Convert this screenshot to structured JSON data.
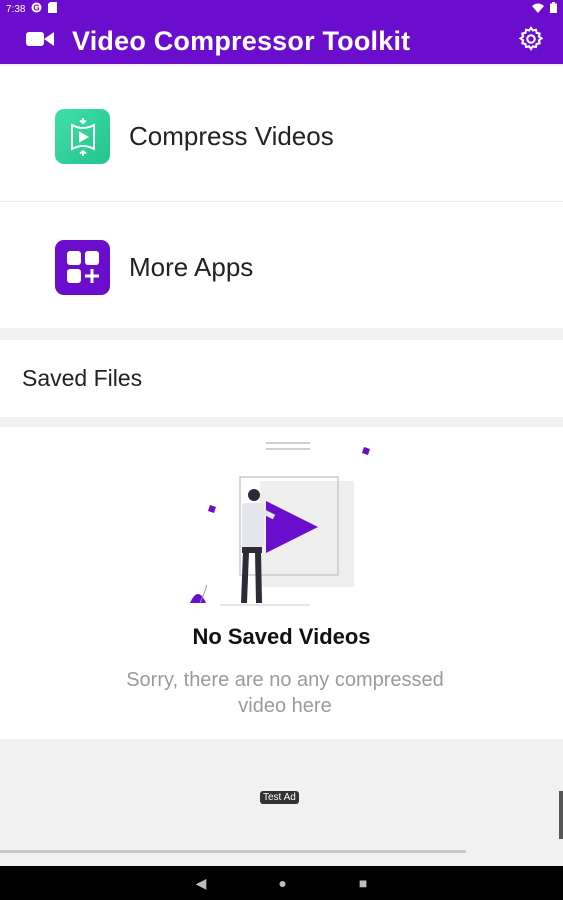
{
  "status_bar": {
    "time": "7:38",
    "left_icons": [
      "google-g-icon",
      "sd-card-icon"
    ],
    "right_icons": [
      "wifi-icon",
      "battery-icon"
    ]
  },
  "app_bar": {
    "title": "Video Compressor Toolkit",
    "left_icon": "video-camera-icon",
    "right_icon": "gear-icon",
    "color": "#6a0dcc"
  },
  "menu": {
    "items": [
      {
        "label": "Compress Videos",
        "icon": "compress-video-icon",
        "icon_color": "#2fd29a"
      },
      {
        "label": "More Apps",
        "icon": "apps-grid-plus-icon",
        "icon_color": "#6a0dcc"
      }
    ]
  },
  "saved_files": {
    "title": "Saved Files"
  },
  "empty_state": {
    "title": "No Saved Videos",
    "subtitle": "Sorry, there are no any compressed video here",
    "illustration": "person-video-player-illustration"
  },
  "ad": {
    "badge": "Test Ad"
  },
  "nav_bar": {
    "back": "◀",
    "home": "●",
    "recents": "■"
  }
}
